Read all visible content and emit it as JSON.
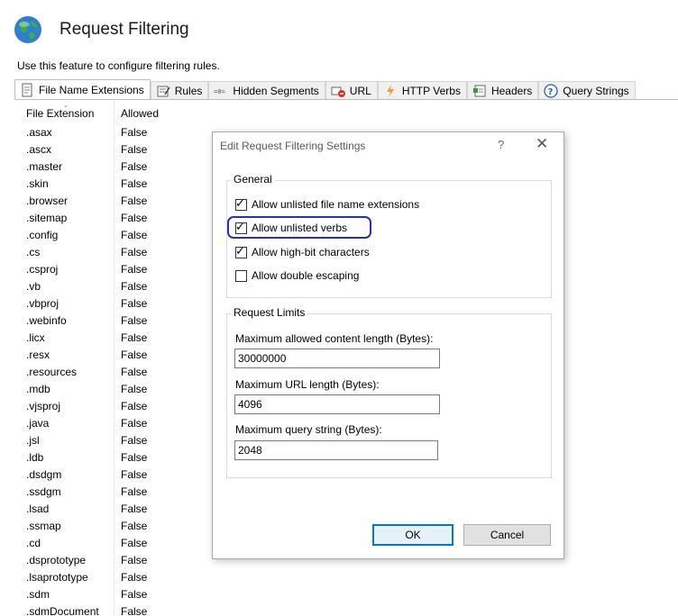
{
  "header": {
    "title": "Request Filtering",
    "description": "Use this feature to configure filtering rules."
  },
  "tabs": [
    {
      "label": "File Name Extensions",
      "icon": "document-icon"
    },
    {
      "label": "Rules",
      "icon": "rules-icon"
    },
    {
      "label": "Hidden Segments",
      "icon": "hidden-segments-icon"
    },
    {
      "label": "URL",
      "icon": "url-icon"
    },
    {
      "label": "HTTP Verbs",
      "icon": "lightning-icon"
    },
    {
      "label": "Headers",
      "icon": "headers-icon"
    },
    {
      "label": "Query Strings",
      "icon": "question-icon"
    }
  ],
  "list": {
    "columns": [
      "File Extension",
      "Allowed"
    ],
    "rows": [
      [
        ".asax",
        "False"
      ],
      [
        ".ascx",
        "False"
      ],
      [
        ".master",
        "False"
      ],
      [
        ".skin",
        "False"
      ],
      [
        ".browser",
        "False"
      ],
      [
        ".sitemap",
        "False"
      ],
      [
        ".config",
        "False"
      ],
      [
        ".cs",
        "False"
      ],
      [
        ".csproj",
        "False"
      ],
      [
        ".vb",
        "False"
      ],
      [
        ".vbproj",
        "False"
      ],
      [
        ".webinfo",
        "False"
      ],
      [
        ".licx",
        "False"
      ],
      [
        ".resx",
        "False"
      ],
      [
        ".resources",
        "False"
      ],
      [
        ".mdb",
        "False"
      ],
      [
        ".vjsproj",
        "False"
      ],
      [
        ".java",
        "False"
      ],
      [
        ".jsl",
        "False"
      ],
      [
        ".ldb",
        "False"
      ],
      [
        ".dsdgm",
        "False"
      ],
      [
        ".ssdgm",
        "False"
      ],
      [
        ".lsad",
        "False"
      ],
      [
        ".ssmap",
        "False"
      ],
      [
        ".cd",
        "False"
      ],
      [
        ".dsprototype",
        "False"
      ],
      [
        ".lsaprototype",
        "False"
      ],
      [
        ".sdm",
        "False"
      ],
      [
        ".sdmDocument",
        "False"
      ]
    ]
  },
  "dialog": {
    "title": "Edit Request Filtering Settings",
    "help": "?",
    "close": "✕",
    "general": {
      "label": "General",
      "options": [
        {
          "label": "Allow unlisted file name extensions",
          "checked": true
        },
        {
          "label": "Allow unlisted verbs",
          "checked": true
        },
        {
          "label": "Allow high-bit characters",
          "checked": true
        },
        {
          "label": "Allow double escaping",
          "checked": false
        }
      ]
    },
    "limits": {
      "label": "Request Limits",
      "content_length_label": "Maximum allowed content length (Bytes):",
      "content_length_value": "30000000",
      "url_length_label": "Maximum URL length (Bytes):",
      "url_length_value": "4096",
      "query_string_label": "Maximum query string (Bytes):",
      "query_string_value": "2048"
    },
    "ok_label": "OK",
    "cancel_label": "Cancel"
  },
  "colors": {
    "highlight": "#2a2fb5",
    "default_button_border": "#0078d7"
  }
}
